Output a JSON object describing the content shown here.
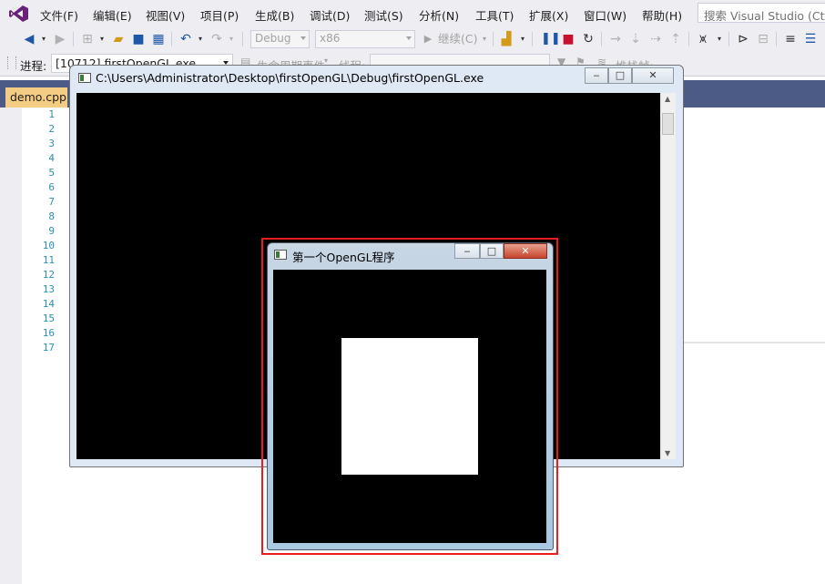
{
  "menubar": {
    "items": [
      "文件(F)",
      "编辑(E)",
      "视图(V)",
      "项目(P)",
      "生成(B)",
      "调试(D)",
      "测试(S)",
      "分析(N)",
      "工具(T)",
      "扩展(X)",
      "窗口(W)",
      "帮助(H)"
    ],
    "search_placeholder": "搜索 Visual Studio (Ctrl+Q)"
  },
  "toolbar": {
    "config": "Debug",
    "platform": "x86",
    "continue_label": "继续(C)"
  },
  "procbar": {
    "process_label": "进程:",
    "process_value": "[10712] firstOpenGL.exe",
    "lifecycle_label": "生命周期事件",
    "thread_label": "线程:",
    "stackframe_label": "堆栈帧:"
  },
  "editor": {
    "tab": "demo.cpp",
    "lines": [
      "1",
      "2",
      "3",
      "4",
      "5",
      "6",
      "7",
      "8",
      "9",
      "10",
      "11",
      "12",
      "13",
      "14",
      "15",
      "16",
      "17"
    ]
  },
  "console": {
    "title": "C:\\Users\\Administrator\\Desktop\\firstOpenGL\\Debug\\firstOpenGL.exe"
  },
  "gl_window": {
    "title": "第一个OpenGL程序"
  },
  "colors": {
    "vs_accent": "#68217a",
    "tab_active": "#f5cc84",
    "highlight": "#e81e1e",
    "line_numbers": "#2b91af"
  }
}
